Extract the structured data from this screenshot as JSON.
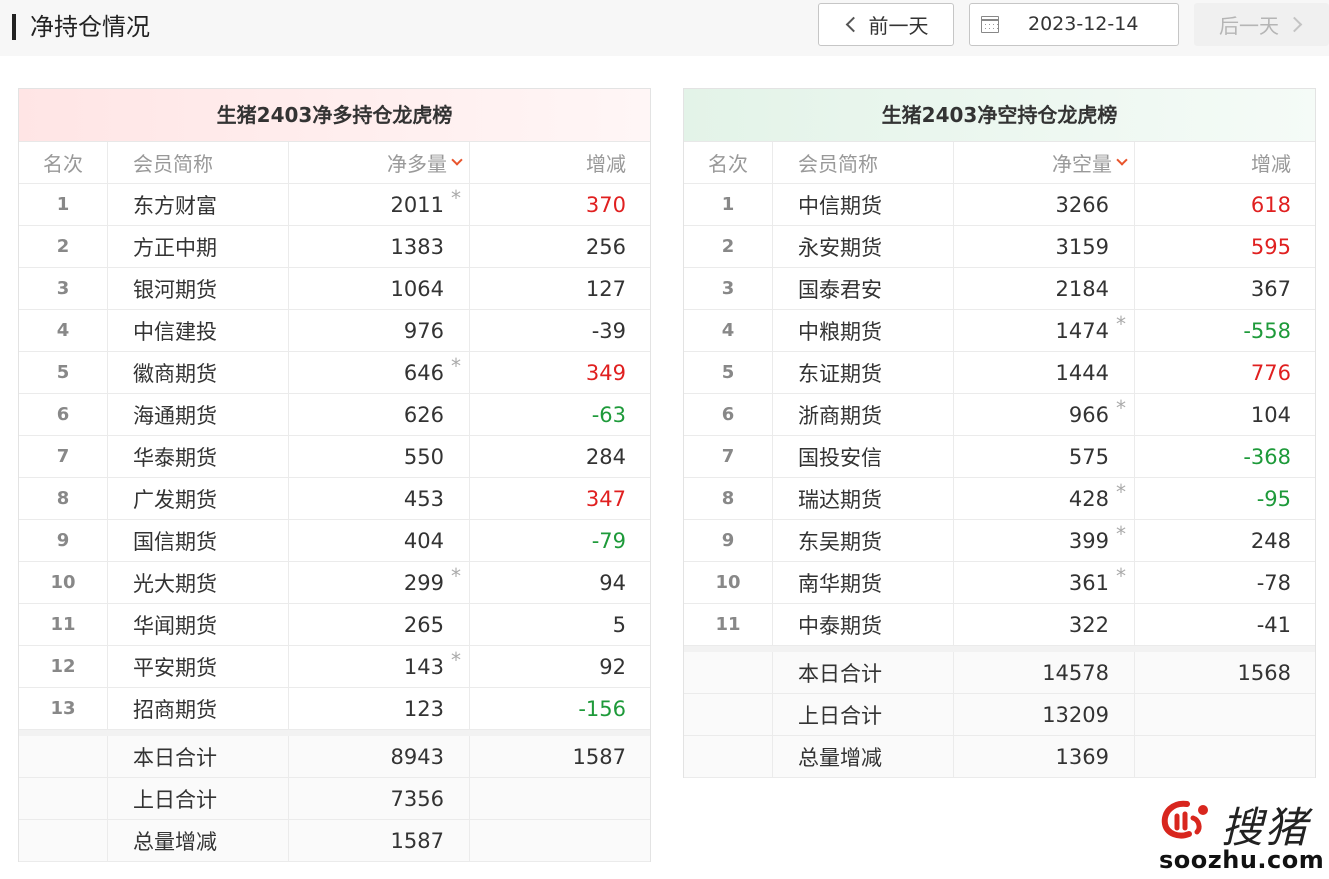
{
  "header": {
    "title": "净持仓情况",
    "prev_label": "前一天",
    "next_label": "后一天",
    "date": "2023-12-14"
  },
  "long_panel": {
    "title": "生猪2403净多持仓龙虎榜",
    "columns": [
      "名次",
      "会员简称",
      "净多量",
      "增减"
    ],
    "rows": [
      {
        "rank": "1",
        "name": "东方财富",
        "amount": "2011",
        "star": true,
        "change": "370",
        "dir": "up"
      },
      {
        "rank": "2",
        "name": "方正中期",
        "amount": "1383",
        "star": false,
        "change": "256",
        "dir": "flat"
      },
      {
        "rank": "3",
        "name": "银河期货",
        "amount": "1064",
        "star": false,
        "change": "127",
        "dir": "flat"
      },
      {
        "rank": "4",
        "name": "中信建投",
        "amount": "976",
        "star": false,
        "change": "-39",
        "dir": "flat"
      },
      {
        "rank": "5",
        "name": "徽商期货",
        "amount": "646",
        "star": true,
        "change": "349",
        "dir": "up"
      },
      {
        "rank": "6",
        "name": "海通期货",
        "amount": "626",
        "star": false,
        "change": "-63",
        "dir": "down"
      },
      {
        "rank": "7",
        "name": "华泰期货",
        "amount": "550",
        "star": false,
        "change": "284",
        "dir": "flat"
      },
      {
        "rank": "8",
        "name": "广发期货",
        "amount": "453",
        "star": false,
        "change": "347",
        "dir": "up"
      },
      {
        "rank": "9",
        "name": "国信期货",
        "amount": "404",
        "star": false,
        "change": "-79",
        "dir": "down"
      },
      {
        "rank": "10",
        "name": "光大期货",
        "amount": "299",
        "star": true,
        "change": "94",
        "dir": "flat"
      },
      {
        "rank": "11",
        "name": "华闻期货",
        "amount": "265",
        "star": false,
        "change": "5",
        "dir": "flat"
      },
      {
        "rank": "12",
        "name": "平安期货",
        "amount": "143",
        "star": true,
        "change": "92",
        "dir": "flat"
      },
      {
        "rank": "13",
        "name": "招商期货",
        "amount": "123",
        "star": false,
        "change": "-156",
        "dir": "down"
      }
    ],
    "summary": [
      {
        "label": "本日合计",
        "amount": "8943",
        "change": "1587"
      },
      {
        "label": "上日合计",
        "amount": "7356",
        "change": ""
      },
      {
        "label": "总量增减",
        "amount": "1587",
        "change": ""
      }
    ]
  },
  "short_panel": {
    "title": "生猪2403净空持仓龙虎榜",
    "columns": [
      "名次",
      "会员简称",
      "净空量",
      "增减"
    ],
    "rows": [
      {
        "rank": "1",
        "name": "中信期货",
        "amount": "3266",
        "star": false,
        "change": "618",
        "dir": "up"
      },
      {
        "rank": "2",
        "name": "永安期货",
        "amount": "3159",
        "star": false,
        "change": "595",
        "dir": "up"
      },
      {
        "rank": "3",
        "name": "国泰君安",
        "amount": "2184",
        "star": false,
        "change": "367",
        "dir": "flat"
      },
      {
        "rank": "4",
        "name": "中粮期货",
        "amount": "1474",
        "star": true,
        "change": "-558",
        "dir": "down"
      },
      {
        "rank": "5",
        "name": "东证期货",
        "amount": "1444",
        "star": false,
        "change": "776",
        "dir": "up"
      },
      {
        "rank": "6",
        "name": "浙商期货",
        "amount": "966",
        "star": true,
        "change": "104",
        "dir": "flat"
      },
      {
        "rank": "7",
        "name": "国投安信",
        "amount": "575",
        "star": false,
        "change": "-368",
        "dir": "down"
      },
      {
        "rank": "8",
        "name": "瑞达期货",
        "amount": "428",
        "star": true,
        "change": "-95",
        "dir": "down"
      },
      {
        "rank": "9",
        "name": "东吴期货",
        "amount": "399",
        "star": true,
        "change": "248",
        "dir": "flat"
      },
      {
        "rank": "10",
        "name": "南华期货",
        "amount": "361",
        "star": true,
        "change": "-78",
        "dir": "flat"
      },
      {
        "rank": "11",
        "name": "中泰期货",
        "amount": "322",
        "star": false,
        "change": "-41",
        "dir": "flat"
      }
    ],
    "summary": [
      {
        "label": "本日合计",
        "amount": "14578",
        "change": "1568"
      },
      {
        "label": "上日合计",
        "amount": "13209",
        "change": ""
      },
      {
        "label": "总量增减",
        "amount": "1369",
        "change": ""
      }
    ]
  },
  "watermark": {
    "name": "搜猪",
    "domain": "soozhu.com"
  },
  "colors": {
    "up": "#e02020",
    "down": "#1e9a3a",
    "sort_accent": "#e8542c"
  },
  "icons": {
    "prev": "chevron-left-icon",
    "next": "chevron-right-icon",
    "calendar": "calendar-icon",
    "sort": "sort-desc-icon",
    "star": "star-icon"
  }
}
